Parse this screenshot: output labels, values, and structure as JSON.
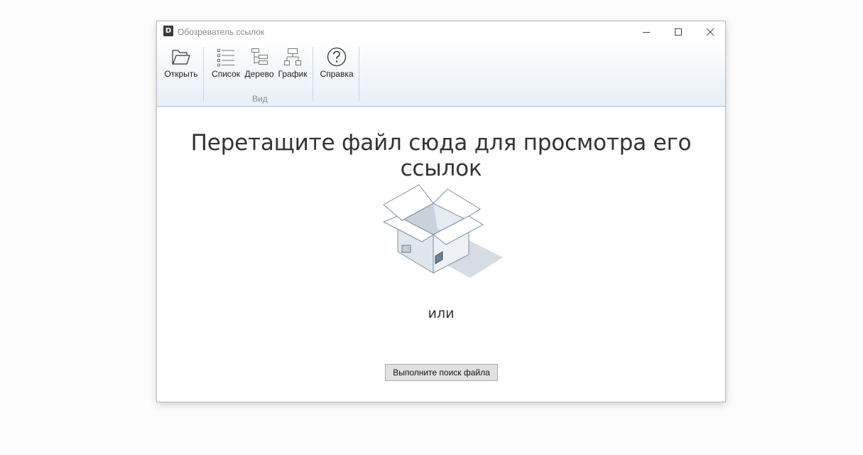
{
  "window": {
    "title": "Обозреватель ссылок",
    "app_icon_letter": "D"
  },
  "ribbon": {
    "open_label": "Открыть",
    "list_label": "Список",
    "tree_label": "Дерево",
    "graph_label": "График",
    "view_group_label": "Вид",
    "help_label": "Справка"
  },
  "main": {
    "heading": "Перетащите файл сюда для просмотра его ссылок",
    "or_text": "или",
    "search_button_label": "Выполните поиск файла"
  },
  "icons": {
    "open": "folder-open-icon",
    "list": "list-view-icon",
    "tree": "tree-view-icon",
    "graph": "graph-view-icon",
    "help": "help-question-icon",
    "minimize": "minimize-icon",
    "maximize": "maximize-icon",
    "close": "close-icon"
  },
  "colors": {
    "ribbon_bottom": "#e9eff8",
    "ribbon_border": "#a9bfd6",
    "button_face": "#e1e1e1"
  }
}
